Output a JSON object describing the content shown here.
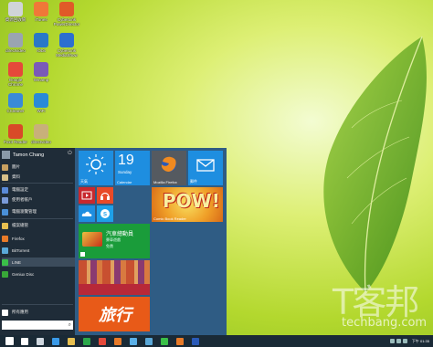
{
  "desktop": {
    "icons": [
      {
        "label": "資源回收筒",
        "icon": "recycle-bin-icon",
        "color": "#d0d4d8"
      },
      {
        "label": "iTunes",
        "icon": "itunes-icon",
        "color": "#f07838"
      },
      {
        "label": "CyberLink PowerDirector",
        "icon": "powerdirector-icon",
        "color": "#e05a28"
      },
      {
        "label": "directvideo",
        "icon": "video-tool-icon",
        "color": "#9aa4b0"
      },
      {
        "label": "IObit",
        "icon": "iobit-icon",
        "color": "#2a78c8"
      },
      {
        "label": "CyberLink MediaShow",
        "icon": "mediashow-icon",
        "color": "#2d6fd0"
      },
      {
        "label": "Google Chrome",
        "icon": "chrome-icon",
        "color": "#e5493a"
      },
      {
        "label": "Winamp",
        "icon": "media-player-icon",
        "color": "#7a5ab8"
      },
      {
        "label": "CCleaner",
        "icon": "app-icon",
        "color": "#3a8ad8"
      },
      {
        "label": "WiFi",
        "icon": "wifi-tool-icon",
        "color": "#2a8ad8"
      },
      {
        "label": "Foxit Reader",
        "icon": "pdf-reader-icon",
        "color": "#d84a28"
      },
      {
        "label": "directvideo",
        "icon": "disc-icon",
        "color": "#c8b07a"
      }
    ]
  },
  "start_menu": {
    "user_name": "Tamon Chang",
    "power_icon": "power-icon",
    "items": [
      {
        "label": "圖片",
        "icon": "pictures-icon",
        "color": "#c8a060"
      },
      {
        "label": "資料",
        "icon": "documents-icon",
        "color": "#d8c088"
      },
      {
        "label": "電腦設定",
        "icon": "settings-icon",
        "color": "#5a8ad8"
      },
      {
        "label": "使用者帳戶",
        "icon": "user-accounts-icon",
        "color": "#7a9ad8"
      },
      {
        "label": "電腦瀏覽管理",
        "icon": "control-panel-icon",
        "color": "#4a90d8"
      },
      {
        "label": "檔案總管",
        "icon": "file-explorer-icon",
        "color": "#e8c050"
      },
      {
        "label": "Firefox",
        "icon": "firefox-icon",
        "color": "#e87a28"
      },
      {
        "label": "BitTorrent",
        "icon": "bittorrent-icon",
        "color": "#5aa8d8"
      },
      {
        "label": "LINE",
        "icon": "line-icon",
        "color": "#3ac048"
      },
      {
        "label": "Geniux Disc",
        "icon": "disc-app-icon",
        "color": "#38a838"
      },
      {
        "label": "所有應用",
        "icon": "all-apps-icon",
        "color": "#ffffff"
      }
    ],
    "search_icon": "search-icon"
  },
  "tiles": {
    "weather": {
      "label": "天氣",
      "icon": "weather-sun-icon",
      "color": "#1e8ee0"
    },
    "calendar": {
      "day": "19",
      "weekday": "Sunday",
      "label": "Calendar",
      "color": "#1e8ee0"
    },
    "firefox": {
      "label": "Mozilla Firefox",
      "icon": "firefox-icon",
      "color": "#555a60"
    },
    "mail": {
      "label": "郵件",
      "icon": "mail-icon",
      "color": "#1e8ee0"
    },
    "video": {
      "icon": "video-play-icon",
      "color": "#c8282e"
    },
    "music": {
      "icon": "headphones-icon",
      "color": "#e84a28"
    },
    "onedrive": {
      "icon": "cloud-icon",
      "color": "#1e8ee0"
    },
    "skype": {
      "icon": "skype-icon",
      "color": "#1ea0e8"
    },
    "game": {
      "label": "Comic Book Reader",
      "art": "POW!",
      "color": "#e8a020"
    },
    "store": {
      "title": "汽車總動員",
      "subtitle": "賽車遊戲",
      "price": "免費",
      "color": "#1a9c3a"
    },
    "photos": {
      "color": "#b83a28"
    },
    "news": {
      "art": "旅行",
      "color": "#e85a18"
    }
  },
  "taskbar": {
    "items": [
      {
        "icon": "start-windows-icon",
        "color": "#ffffff"
      },
      {
        "icon": "search-icon",
        "color": "#ffffff"
      },
      {
        "icon": "task-view-icon",
        "color": "#d0d8e0"
      },
      {
        "icon": "ie-icon",
        "color": "#3a9ae8"
      },
      {
        "icon": "folder-icon",
        "color": "#e8c050"
      },
      {
        "icon": "store-icon",
        "color": "#2aa84a"
      },
      {
        "icon": "chrome-icon",
        "color": "#e5493a"
      },
      {
        "icon": "paint-icon",
        "color": "#e87a28"
      },
      {
        "icon": "photos-icon",
        "color": "#5ab0e8"
      },
      {
        "icon": "notepad-icon",
        "color": "#5aa8d8"
      },
      {
        "icon": "line-icon",
        "color": "#3ac048"
      },
      {
        "icon": "firefox-icon",
        "color": "#e87a28"
      },
      {
        "icon": "word-icon",
        "color": "#2a5ab8"
      }
    ],
    "clock": "下午 01:35"
  },
  "watermark": {
    "line1": "T客邦",
    "line2": "techbang.com"
  }
}
